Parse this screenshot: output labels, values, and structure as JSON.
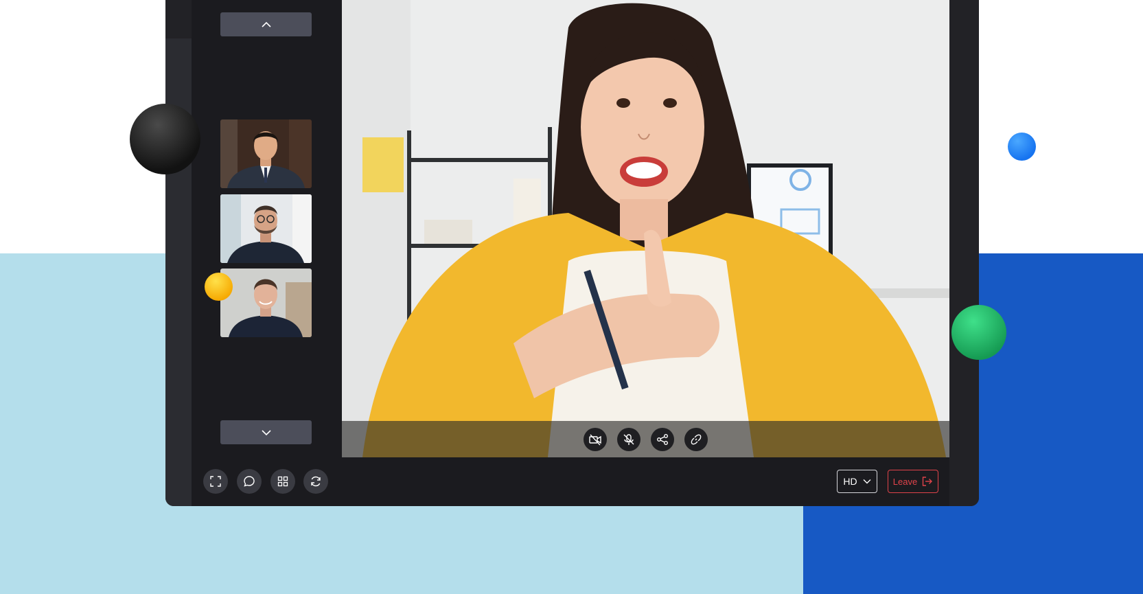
{
  "sidebar": {
    "scroll_up": "chevron-up-icon",
    "scroll_down": "chevron-down-icon",
    "participants": [
      {
        "icon": "participant-businessman-suit"
      },
      {
        "icon": "participant-man-glasses"
      },
      {
        "icon": "participant-man-smiling"
      }
    ]
  },
  "main_video": {
    "icon": "speaker-woman-yellow-jacket"
  },
  "call_controls": [
    {
      "name": "camera-off-icon"
    },
    {
      "name": "mic-off-icon"
    },
    {
      "name": "share-icon"
    },
    {
      "name": "link-icon"
    }
  ],
  "toolbar": {
    "tools": [
      {
        "name": "fullscreen-icon"
      },
      {
        "name": "chat-icon"
      },
      {
        "name": "grid-layout-icon"
      },
      {
        "name": "refresh-icon"
      }
    ],
    "quality": "HD",
    "leave_label": "Leave"
  },
  "colors": {
    "background_light": "#b4deeb",
    "background_dark": "#1759c4",
    "leave_accent": "#e0434a",
    "panel": "#1b1b1f"
  }
}
